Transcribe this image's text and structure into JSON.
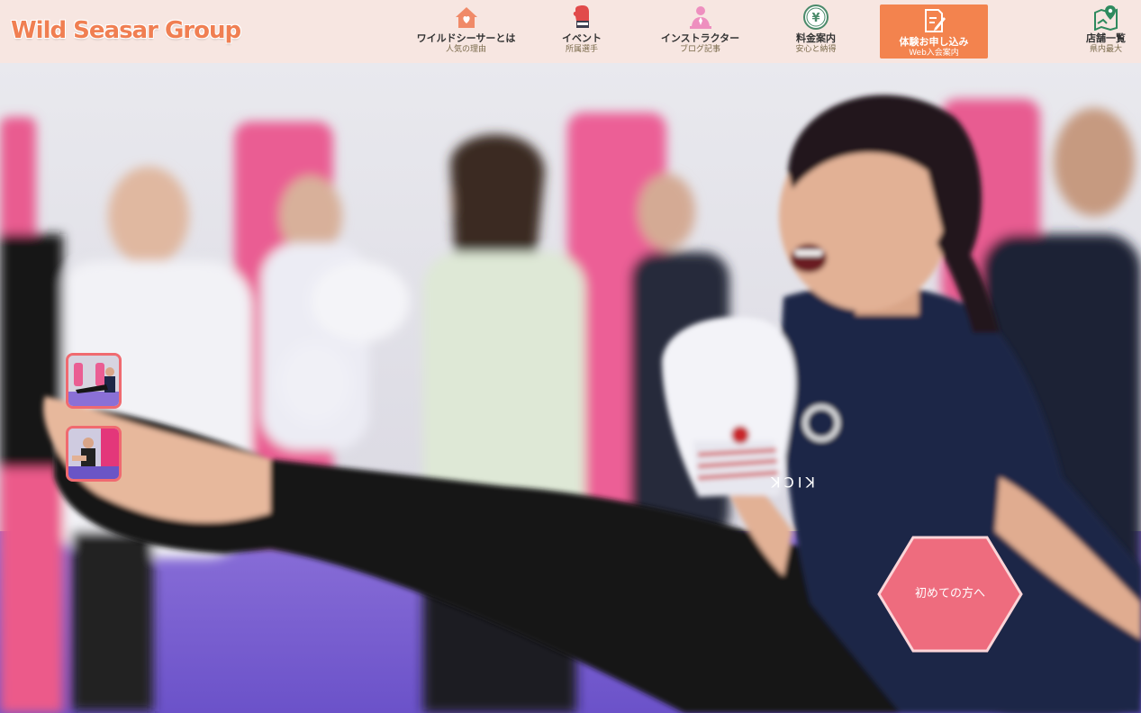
{
  "header": {
    "logo_text": "Wild Seasar Group",
    "nav": [
      {
        "title": "ワイルドシーサーとは",
        "sub": "人気の理由",
        "icon": "house-heart-icon"
      },
      {
        "title": "イベント",
        "sub": "所属選手",
        "icon": "boxing-glove-icon"
      },
      {
        "title": "インストラクター",
        "sub": "ブログ記事",
        "icon": "instructor-icon"
      },
      {
        "title": "料金案内",
        "sub": "安心と納得",
        "icon": "yen-coin-icon"
      },
      {
        "title": "体験お申し込み",
        "sub": "Web入会案内",
        "icon": "edit-form-icon"
      },
      {
        "title": "店舗一覧",
        "sub": "県内最大",
        "icon": "map-pin-icon"
      }
    ]
  },
  "hero": {
    "shirt_text": "KICK",
    "thumbnails": [
      {
        "name": "slide-thumbnail-1"
      },
      {
        "name": "slide-thumbnail-2"
      }
    ],
    "cta_label": "初めての方へ"
  },
  "colors": {
    "header_bg": "#f7e6e1",
    "accent_orange": "#f3834e",
    "logo_orange": "#f07f52",
    "hex_pink": "#ee6c7e"
  }
}
